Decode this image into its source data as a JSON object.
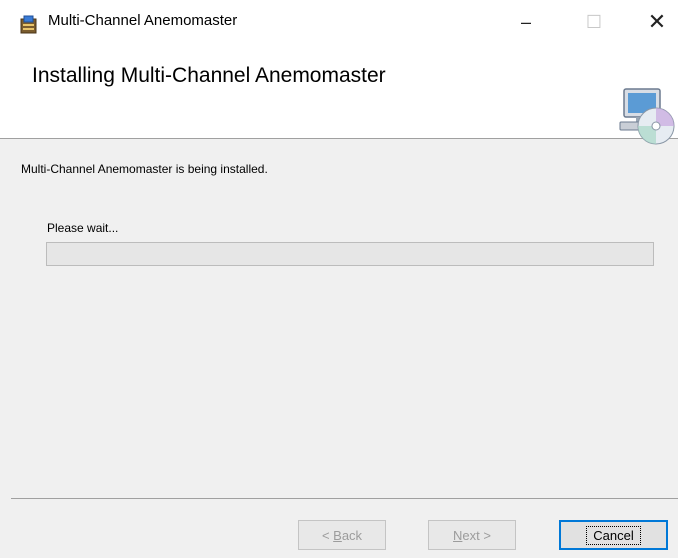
{
  "window": {
    "title": "Multi-Channel Anemomaster",
    "minimize_glyph": "–",
    "maximize_glyph": "☐",
    "close_glyph": "✕",
    "icon": "installer-icon"
  },
  "header": {
    "title": "Installing Multi-Channel Anemomaster",
    "icon": "computer-disc-icon"
  },
  "body": {
    "status_text": "Multi-Channel Anemomaster is being installed.",
    "wait_label": "Please wait...",
    "progress_value": 0
  },
  "buttons": {
    "back_prefix": "< ",
    "back_mnemonic": "B",
    "back_rest": "ack",
    "next_mnemonic": "N",
    "next_rest": "ext >",
    "cancel": "Cancel"
  },
  "colors": {
    "accent": "#0078d7",
    "progress": "#06b025"
  }
}
